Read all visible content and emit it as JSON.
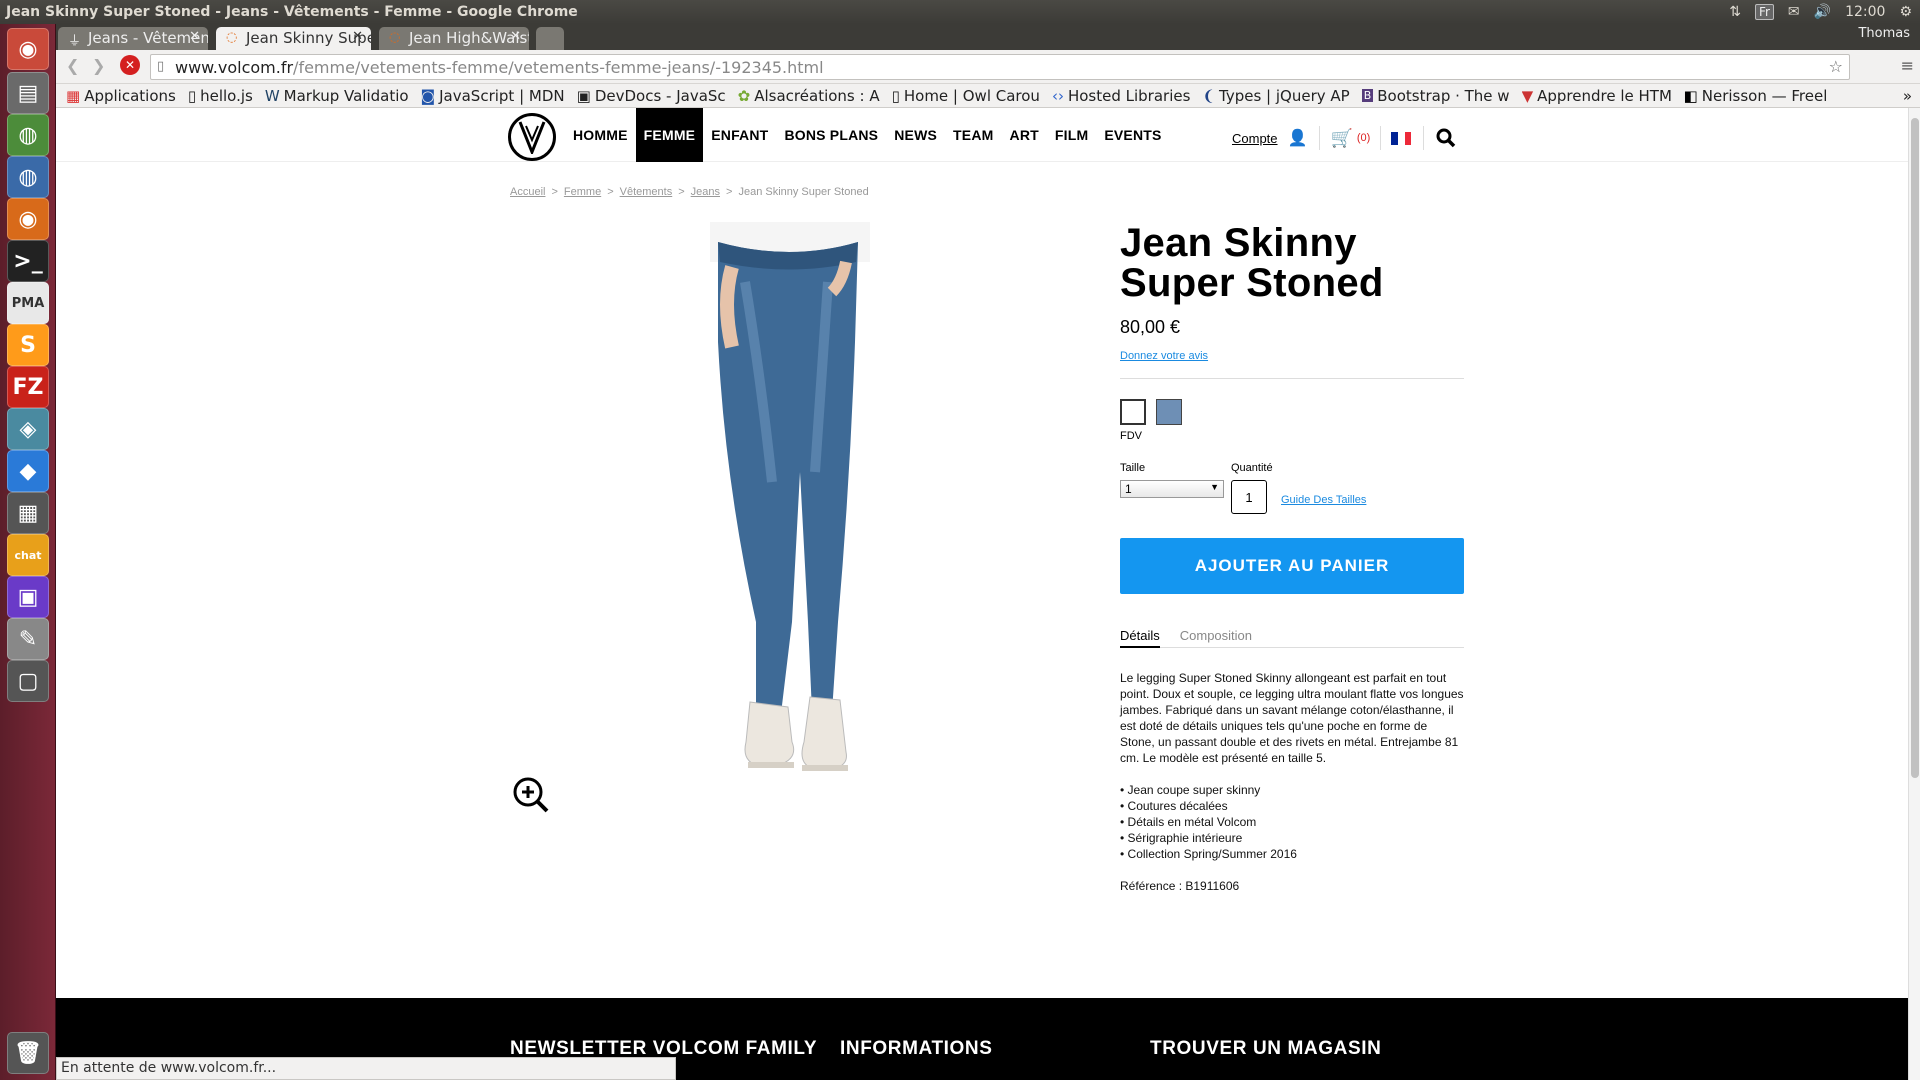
{
  "os": {
    "window_title": "Jean Skinny Super Stoned - Jeans - Vêtements - Femme - Google Chrome",
    "keyboard": "Fr",
    "clock": "12:00",
    "user": "Thomas"
  },
  "browser": {
    "tabs": [
      {
        "label": "Jeans - Vêtements - F"
      },
      {
        "label": "Jean Skinny Super St"
      },
      {
        "label": "Jean High&Waisted"
      }
    ],
    "url_host": "www.volcom.fr",
    "url_path": "/femme/vetements-femme/vetements-femme-jeans/-192345.html",
    "bookmarks": [
      "Applications",
      "hello.js",
      "Markup Validatio",
      "JavaScript | MDN",
      "DevDocs - JavaSc",
      "Alsacréations : A",
      "Home | Owl Carou",
      "Hosted Libraries",
      "Types | jQuery AP",
      "Bootstrap · The w",
      "Apprendre le HTM",
      "Nerisson — Freel"
    ],
    "status": "En attente de www.volcom.fr..."
  },
  "site": {
    "nav": [
      "HOMME",
      "FEMME",
      "ENFANT",
      "BONS PLANS",
      "NEWS",
      "TEAM",
      "ART",
      "FILM",
      "EVENTS"
    ],
    "account": "Compte",
    "cart_count": "(0)"
  },
  "breadcrumb": [
    "Accueil",
    "Femme",
    "Vêtements",
    "Jeans",
    "Jean Skinny Super Stoned"
  ],
  "product": {
    "title_line1": "Jean Skinny",
    "title_line2": "Super Stoned",
    "price": "80,00 €",
    "review_link": "Donnez votre avis",
    "color_label": "FDV",
    "size_label": "Taille",
    "size_value": "1",
    "qty_label": "Quantité",
    "qty_value": "1",
    "size_guide": "Guide Des Tailles",
    "add_to_cart": "AJOUTER AU PANIER",
    "tab_details": "Détails",
    "tab_composition": "Composition",
    "description": "Le legging Super Stoned Skinny allongeant est parfait en tout point. Doux et souple, ce legging ultra moulant flatte vos longues jambes. Fabriqué dans un savant mélange coton/élasthanne, il est doté de détails uniques tels qu'une poche en forme de Stone, un passant double et des rivets en métal. Entrejambe 81 cm. Le modèle est présenté en taille 5.",
    "bullets": [
      "• Jean coupe super skinny",
      "• Coutures décalées",
      "• Détails en métal Volcom",
      "• Sérigraphie intérieure",
      "• Collection Spring/Summer 2016"
    ],
    "reference": "Référence : B1911606"
  },
  "footer": [
    "NEWSLETTER VOLCOM FAMILY",
    "INFORMATIONS",
    "TROUVER UN MAGASIN"
  ]
}
